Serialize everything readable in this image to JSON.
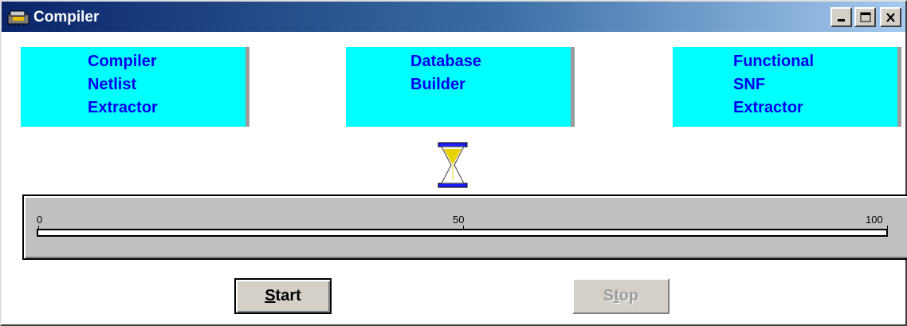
{
  "window": {
    "title": "Compiler",
    "colors": {
      "title_start": "#0a246a",
      "title_end": "#a6caf0",
      "panel": "#00ffff",
      "panel_text": "#0000ee"
    }
  },
  "title_buttons": [
    {
      "name": "minimize",
      "icon": "minimize-icon"
    },
    {
      "name": "maximize",
      "icon": "maximize-icon"
    },
    {
      "name": "close",
      "icon": "close-icon"
    }
  ],
  "panels": [
    {
      "label": "Compiler\nNetlist\nExtractor"
    },
    {
      "label": "Database\nBuilder"
    },
    {
      "label": "Functional\nSNF\nExtractor"
    }
  ],
  "status_icon": "hourglass-icon",
  "progress": {
    "ticks": [
      "0",
      "50",
      "100"
    ],
    "value": 0
  },
  "buttons": {
    "start": {
      "mnemonic": "S",
      "rest": "tart",
      "enabled": true
    },
    "stop": {
      "prefix": "S",
      "mnemonic": "t",
      "rest": "op",
      "enabled": false
    }
  }
}
